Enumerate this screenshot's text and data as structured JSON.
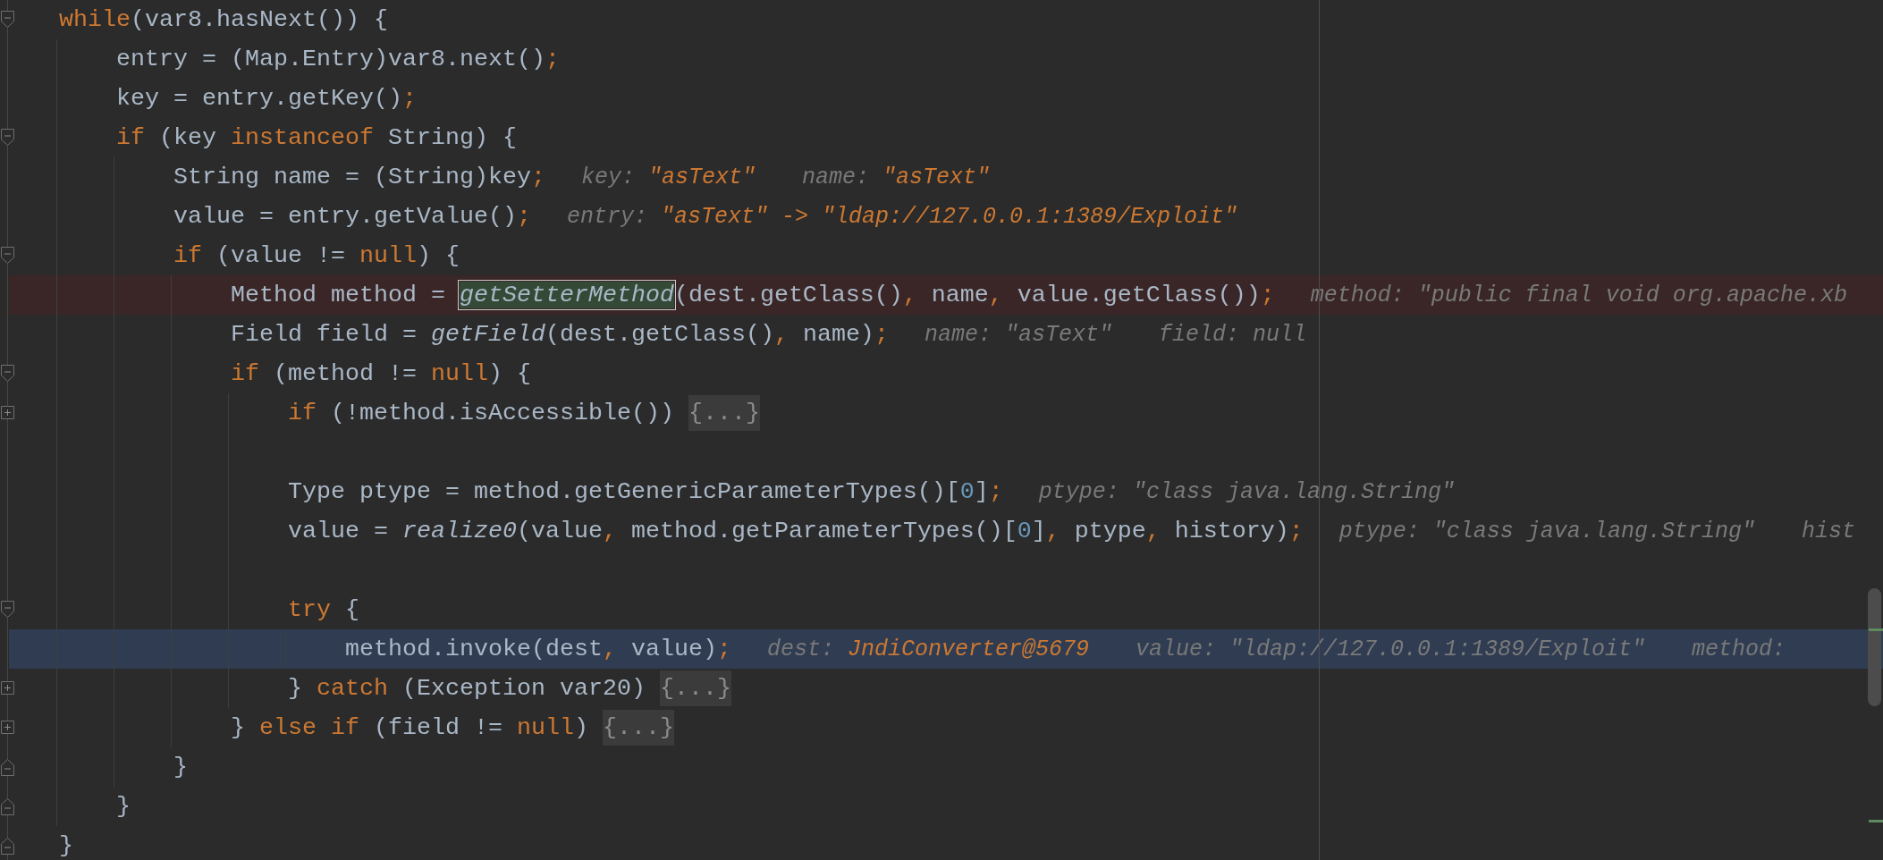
{
  "editor": {
    "lines": [
      {
        "kind": "code",
        "fold": {
          "kind": "start"
        },
        "tokens": [
          {
            "t": "while",
            "kind": "keyword"
          },
          {
            "t": "(var8.hasNext()) {",
            "kind": "plain"
          }
        ],
        "children": [
          {
            "kind": "code",
            "tokens": [
              {
                "t": "entry = (Map.Entry)var8.next()",
                "kind": "plain"
              },
              {
                "t": ";",
                "kind": "punct"
              }
            ]
          },
          {
            "kind": "code",
            "tokens": [
              {
                "t": "key = entry.getKey()",
                "kind": "plain"
              },
              {
                "t": ";",
                "kind": "punct"
              }
            ]
          },
          {
            "kind": "code",
            "fold": {
              "kind": "start"
            },
            "tokens": [
              {
                "t": "if",
                "kind": "keyword"
              },
              {
                "t": " (key ",
                "kind": "plain"
              },
              {
                "t": "instanceof",
                "kind": "keyword"
              },
              {
                "t": " String) {",
                "kind": "plain"
              }
            ],
            "children": [
              {
                "kind": "code",
                "tokens": [
                  {
                    "t": "String name = (String)key",
                    "kind": "plain"
                  },
                  {
                    "t": ";",
                    "kind": "punct"
                  }
                ],
                "hints": [
                  {
                    "label": "key:",
                    "value": "\"asText\"",
                    "changed": true
                  },
                  {
                    "label": "name:",
                    "value": "\"asText\"",
                    "changed": true
                  }
                ]
              },
              {
                "kind": "code",
                "tokens": [
                  {
                    "t": "value = entry.getValue()",
                    "kind": "plain"
                  },
                  {
                    "t": ";",
                    "kind": "punct"
                  }
                ],
                "hints": [
                  {
                    "label": "entry:",
                    "value": "\"asText\" -> \"ldap://127.0.0.1:1389/Exploit\"",
                    "changed": true
                  }
                ]
              },
              {
                "kind": "code",
                "fold": {
                  "kind": "start"
                },
                "tokens": [
                  {
                    "t": "if",
                    "kind": "keyword"
                  },
                  {
                    "t": " (value != ",
                    "kind": "plain"
                  },
                  {
                    "t": "null",
                    "kind": "keyword"
                  },
                  {
                    "t": ") {",
                    "kind": "plain"
                  }
                ],
                "children": [
                  {
                    "kind": "code",
                    "highlight": {
                      "kind": "breakpoint"
                    },
                    "tokens": [
                      {
                        "t": "Method method = ",
                        "kind": "plain"
                      },
                      {
                        "t": "getSetterMethod",
                        "kind": "match"
                      },
                      {
                        "t": "(dest.getClass()",
                        "kind": "plain"
                      },
                      {
                        "t": ",",
                        "kind": "punct"
                      },
                      {
                        "t": " name",
                        "kind": "plain"
                      },
                      {
                        "t": ",",
                        "kind": "punct"
                      },
                      {
                        "t": " value.getClass())",
                        "kind": "plain"
                      },
                      {
                        "t": ";",
                        "kind": "punct"
                      }
                    ],
                    "hints": [
                      {
                        "label": "method:",
                        "value": "\"public final void org.apache.xb",
                        "changed": false
                      }
                    ]
                  },
                  {
                    "kind": "code",
                    "tokens": [
                      {
                        "t": "Field field = ",
                        "kind": "plain"
                      },
                      {
                        "t": "getField",
                        "kind": "call"
                      },
                      {
                        "t": "(dest.getClass()",
                        "kind": "plain"
                      },
                      {
                        "t": ",",
                        "kind": "punct"
                      },
                      {
                        "t": " name)",
                        "kind": "plain"
                      },
                      {
                        "t": ";",
                        "kind": "punct"
                      }
                    ],
                    "hints": [
                      {
                        "label": "name:",
                        "value": "\"asText\"",
                        "changed": false
                      },
                      {
                        "label": "field:",
                        "value": "null",
                        "changed": false
                      }
                    ]
                  },
                  {
                    "kind": "code",
                    "fold": {
                      "kind": "start"
                    },
                    "tokens": [
                      {
                        "t": "if",
                        "kind": "keyword"
                      },
                      {
                        "t": " (method != ",
                        "kind": "plain"
                      },
                      {
                        "t": "null",
                        "kind": "keyword"
                      },
                      {
                        "t": ") {",
                        "kind": "plain"
                      }
                    ],
                    "children": [
                      {
                        "kind": "code",
                        "fold": {
                          "kind": "collapsed"
                        },
                        "tokens": [
                          {
                            "t": "if",
                            "kind": "keyword"
                          },
                          {
                            "t": " (!method.isAccessible()) ",
                            "kind": "plain"
                          },
                          {
                            "t": "{...}",
                            "kind": "folded"
                          }
                        ]
                      },
                      {
                        "kind": "blank"
                      },
                      {
                        "kind": "code",
                        "tokens": [
                          {
                            "t": "Type ptype = method.getGenericParameterTypes()[",
                            "kind": "plain"
                          },
                          {
                            "t": "0",
                            "kind": "number"
                          },
                          {
                            "t": "]",
                            "kind": "plain"
                          },
                          {
                            "t": ";",
                            "kind": "punct"
                          }
                        ],
                        "hints": [
                          {
                            "label": "ptype:",
                            "value": "\"class java.lang.String\"",
                            "changed": false
                          }
                        ]
                      },
                      {
                        "kind": "code",
                        "tokens": [
                          {
                            "t": "value = ",
                            "kind": "plain"
                          },
                          {
                            "t": "realize0",
                            "kind": "call"
                          },
                          {
                            "t": "(value",
                            "kind": "plain"
                          },
                          {
                            "t": ",",
                            "kind": "punct"
                          },
                          {
                            "t": " method.getParameterTypes()[",
                            "kind": "plain"
                          },
                          {
                            "t": "0",
                            "kind": "number"
                          },
                          {
                            "t": "]",
                            "kind": "plain"
                          },
                          {
                            "t": ",",
                            "kind": "punct"
                          },
                          {
                            "t": " ptype",
                            "kind": "plain"
                          },
                          {
                            "t": ",",
                            "kind": "punct"
                          },
                          {
                            "t": " history)",
                            "kind": "plain"
                          },
                          {
                            "t": ";",
                            "kind": "punct"
                          }
                        ],
                        "hints": [
                          {
                            "label": "ptype:",
                            "value": "\"class java.lang.String\"",
                            "changed": false
                          },
                          {
                            "label": "hist",
                            "changed": false
                          }
                        ]
                      },
                      {
                        "kind": "blank"
                      },
                      {
                        "kind": "code",
                        "fold": {
                          "kind": "start"
                        },
                        "tokens": [
                          {
                            "t": "try",
                            "kind": "keyword"
                          },
                          {
                            "t": " {",
                            "kind": "plain"
                          }
                        ],
                        "children": [
                          {
                            "kind": "code",
                            "highlight": {
                              "kind": "execution"
                            },
                            "tokens": [
                              {
                                "t": "method.invoke(dest",
                                "kind": "plain"
                              },
                              {
                                "t": ",",
                                "kind": "punct"
                              },
                              {
                                "t": " value)",
                                "kind": "plain"
                              },
                              {
                                "t": ";",
                                "kind": "punct"
                              }
                            ],
                            "hints": [
                              {
                                "label": "dest:",
                                "value": "JndiConverter@5679",
                                "changed": true
                              },
                              {
                                "label": "value:",
                                "value": "\"ldap://127.0.0.1:1389/Exploit\"",
                                "changed": false
                              },
                              {
                                "label": "method:",
                                "changed": false
                              }
                            ]
                          }
                        ]
                      },
                      {
                        "kind": "code",
                        "fold": {
                          "kind": "collapsed"
                        },
                        "tokens": [
                          {
                            "t": "} ",
                            "kind": "plain"
                          },
                          {
                            "t": "catch",
                            "kind": "keyword"
                          },
                          {
                            "t": " (Exception var20) ",
                            "kind": "plain"
                          },
                          {
                            "t": "{...}",
                            "kind": "folded"
                          }
                        ]
                      }
                    ]
                  },
                  {
                    "kind": "code",
                    "fold": {
                      "kind": "collapsed"
                    },
                    "tokens": [
                      {
                        "t": "} ",
                        "kind": "plain"
                      },
                      {
                        "t": "else if",
                        "kind": "keyword"
                      },
                      {
                        "t": " (field != ",
                        "kind": "plain"
                      },
                      {
                        "t": "null",
                        "kind": "keyword"
                      },
                      {
                        "t": ") ",
                        "kind": "plain"
                      },
                      {
                        "t": "{...}",
                        "kind": "folded"
                      }
                    ]
                  }
                ]
              },
              {
                "kind": "code",
                "fold": {
                  "kind": "end"
                },
                "tokens": [
                  {
                    "t": "}",
                    "kind": "plain"
                  }
                ]
              }
            ]
          },
          {
            "kind": "code",
            "fold": {
              "kind": "end"
            },
            "tokens": [
              {
                "t": "}",
                "kind": "plain"
              }
            ]
          }
        ]
      },
      {
        "kind": "code",
        "fold": {
          "kind": "end"
        },
        "tokens": [
          {
            "t": "}",
            "kind": "plain"
          }
        ]
      }
    ]
  }
}
